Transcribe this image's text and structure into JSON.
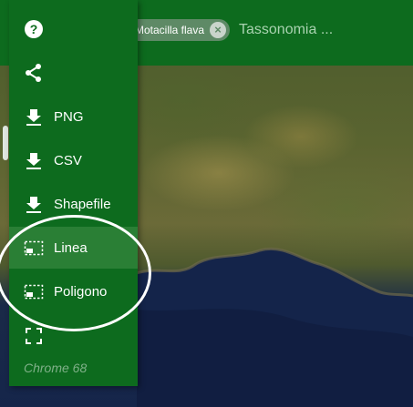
{
  "topbar": {
    "chip_label": "Motacilla flava",
    "chip_close": "×",
    "taxonomy_placeholder": "Tassonomia ..."
  },
  "menu": {
    "items": [
      {
        "label": "",
        "icon": "help-icon"
      },
      {
        "label": "",
        "icon": "share-icon"
      },
      {
        "label": "PNG",
        "icon": "download-icon"
      },
      {
        "label": "CSV",
        "icon": "download-icon"
      },
      {
        "label": "Shapefile",
        "icon": "download-icon"
      },
      {
        "label": "Linea",
        "icon": "select-line-icon"
      },
      {
        "label": "Poligono",
        "icon": "select-polygon-icon"
      },
      {
        "label": "",
        "icon": "fullscreen-icon"
      }
    ],
    "footer": "Chrome 68"
  },
  "colors": {
    "brand_green": "#0d6b1e",
    "active_green": "#2a7f35",
    "chip": "#5e8a66"
  }
}
